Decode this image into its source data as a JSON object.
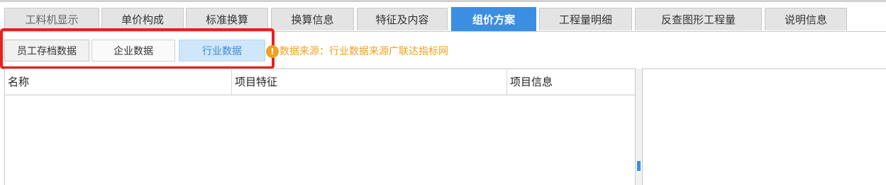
{
  "tabs": [
    {
      "label": "工料机显示",
      "active": false
    },
    {
      "label": "单价构成",
      "active": false
    },
    {
      "label": "标准换算",
      "active": false
    },
    {
      "label": "换算信息",
      "active": false
    },
    {
      "label": "特征及内容",
      "active": false
    },
    {
      "label": "组价方案",
      "active": true
    },
    {
      "label": "工程量明细",
      "active": false
    },
    {
      "label": "反查图形工程量",
      "active": false
    },
    {
      "label": "说明信息",
      "active": false
    }
  ],
  "data_source_buttons": [
    {
      "label": "员工存档数据",
      "selected": false
    },
    {
      "label": "企业数据",
      "selected": false
    },
    {
      "label": "行业数据",
      "selected": true
    }
  ],
  "notice": {
    "icon": "!",
    "text": "数据来源：行业数据来源广联达指标网",
    "color": "#f0a11f"
  },
  "grid": {
    "columns": [
      "名称",
      "项目特征",
      "项目信息"
    ],
    "rows": []
  },
  "colors": {
    "accent": "#3b8fe3",
    "highlight_frame": "#e8211e",
    "selected_button_bg": "#cfe6fb"
  }
}
